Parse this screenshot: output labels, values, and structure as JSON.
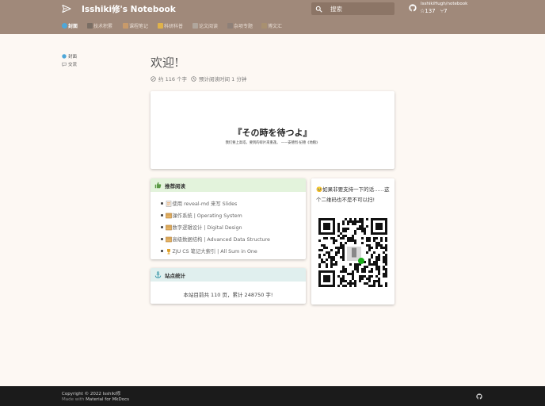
{
  "header": {
    "site_title": "Isshiki修's Notebook",
    "search_placeholder": "搜索",
    "repo_name": "IsshikiHugh/notebook",
    "stars": "☆137",
    "forks": "⑂7"
  },
  "tabs": [
    {
      "label": "封面",
      "icon": "cover-icon",
      "color": "#4ea7d8",
      "active": true
    },
    {
      "label": "技术积累",
      "icon": "tech-icon",
      "color": "#7a6e64",
      "active": false
    },
    {
      "label": "课程笔记",
      "icon": "course-icon",
      "color": "#c89a6a",
      "active": false
    },
    {
      "label": "科研科普",
      "icon": "research-icon",
      "color": "#e0b24a",
      "active": false
    },
    {
      "label": "论文阅读",
      "icon": "paper-icon",
      "color": "#b0a69c",
      "active": false
    },
    {
      "label": "杂项专题",
      "icon": "misc-icon",
      "color": "#8e8078",
      "active": false
    },
    {
      "label": "博文汇",
      "icon": "blog-icon",
      "color": "#a89070",
      "active": false
    }
  ],
  "sidebar": {
    "items": [
      {
        "label": "封面",
        "icon": "cover-icon"
      },
      {
        "label": "交流",
        "icon": "chat-icon"
      }
    ]
  },
  "main": {
    "title": "欢迎!",
    "meta_words": "约 116 个字",
    "meta_time": "预计阅读时间 1 分钟"
  },
  "quote": {
    "title": "『その時を待つよ』",
    "subtitle": "我们要上高塔，要到的碎片来重逢。 ——安德烈·纪德《地粮》"
  },
  "recommend": {
    "heading": "推荐阅读",
    "items": [
      {
        "text": "使用 reveal-md 来写 Slides",
        "icon": "document-icon"
      },
      {
        "text": "操作系统 | Operating System",
        "icon": "box-icon"
      },
      {
        "text": "数字逻辑设计 | Digital Design",
        "icon": "box-icon"
      },
      {
        "text": "高级数据结构 | Advanced Data Structure",
        "icon": "box-icon"
      },
      {
        "text": "ZJU CS 笔记大索引 | All Sum in One",
        "icon": "trophy-icon"
      }
    ]
  },
  "stats": {
    "heading": "站点统计",
    "text": "本站目前共 110 页，累计 248750 字!"
  },
  "donate": {
    "text": "🥺如果非要支持一下的话……这个二维码也不是不可以扫!"
  },
  "footer": {
    "copyright": "Copyright © 2022 Isshiki修",
    "made_prefix": "Made with",
    "made_link": "Material for MkDocs"
  },
  "colors": {
    "header_bg": "#a0897a",
    "page_bg": "#fdf8f3",
    "recommend_head_bg": "#e3f3dc",
    "stats_head_bg": "#e0efee",
    "footer_bg": "#1b1b1b"
  }
}
